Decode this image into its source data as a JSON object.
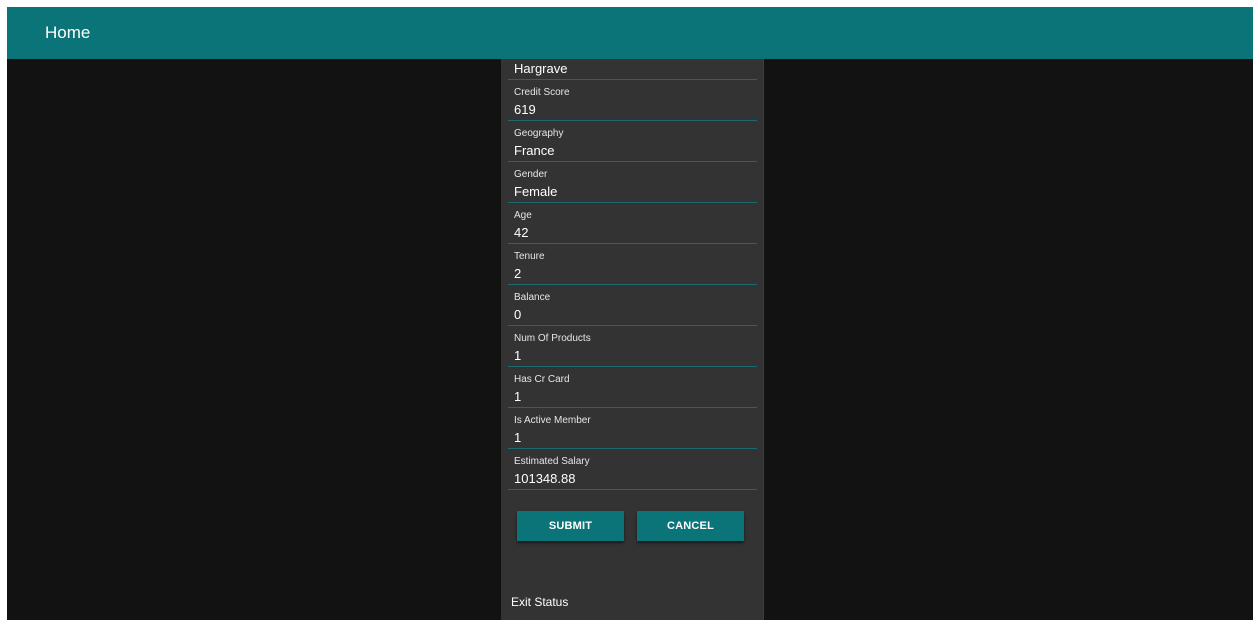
{
  "header": {
    "title": "Home",
    "color": "#0a7479"
  },
  "form": {
    "first_value": "Hargrave",
    "fields": [
      {
        "label": "Credit Score",
        "value": "619"
      },
      {
        "label": "Geography",
        "value": "France"
      },
      {
        "label": "Gender",
        "value": "Female"
      },
      {
        "label": "Age",
        "value": "42"
      },
      {
        "label": "Tenure",
        "value": "2"
      },
      {
        "label": "Balance",
        "value": "0"
      },
      {
        "label": "Num Of Products",
        "value": "1"
      },
      {
        "label": "Has Cr Card",
        "value": "1"
      },
      {
        "label": "Is Active Member",
        "value": "1"
      },
      {
        "label": "Estimated Salary",
        "value": "101348.88"
      }
    ],
    "submit_label": "SUBMIT",
    "cancel_label": "CANCEL",
    "exit_status_label": "Exit Status"
  },
  "colors": {
    "accent": "#0a7479",
    "background": "#121212",
    "panel": "#333333"
  }
}
